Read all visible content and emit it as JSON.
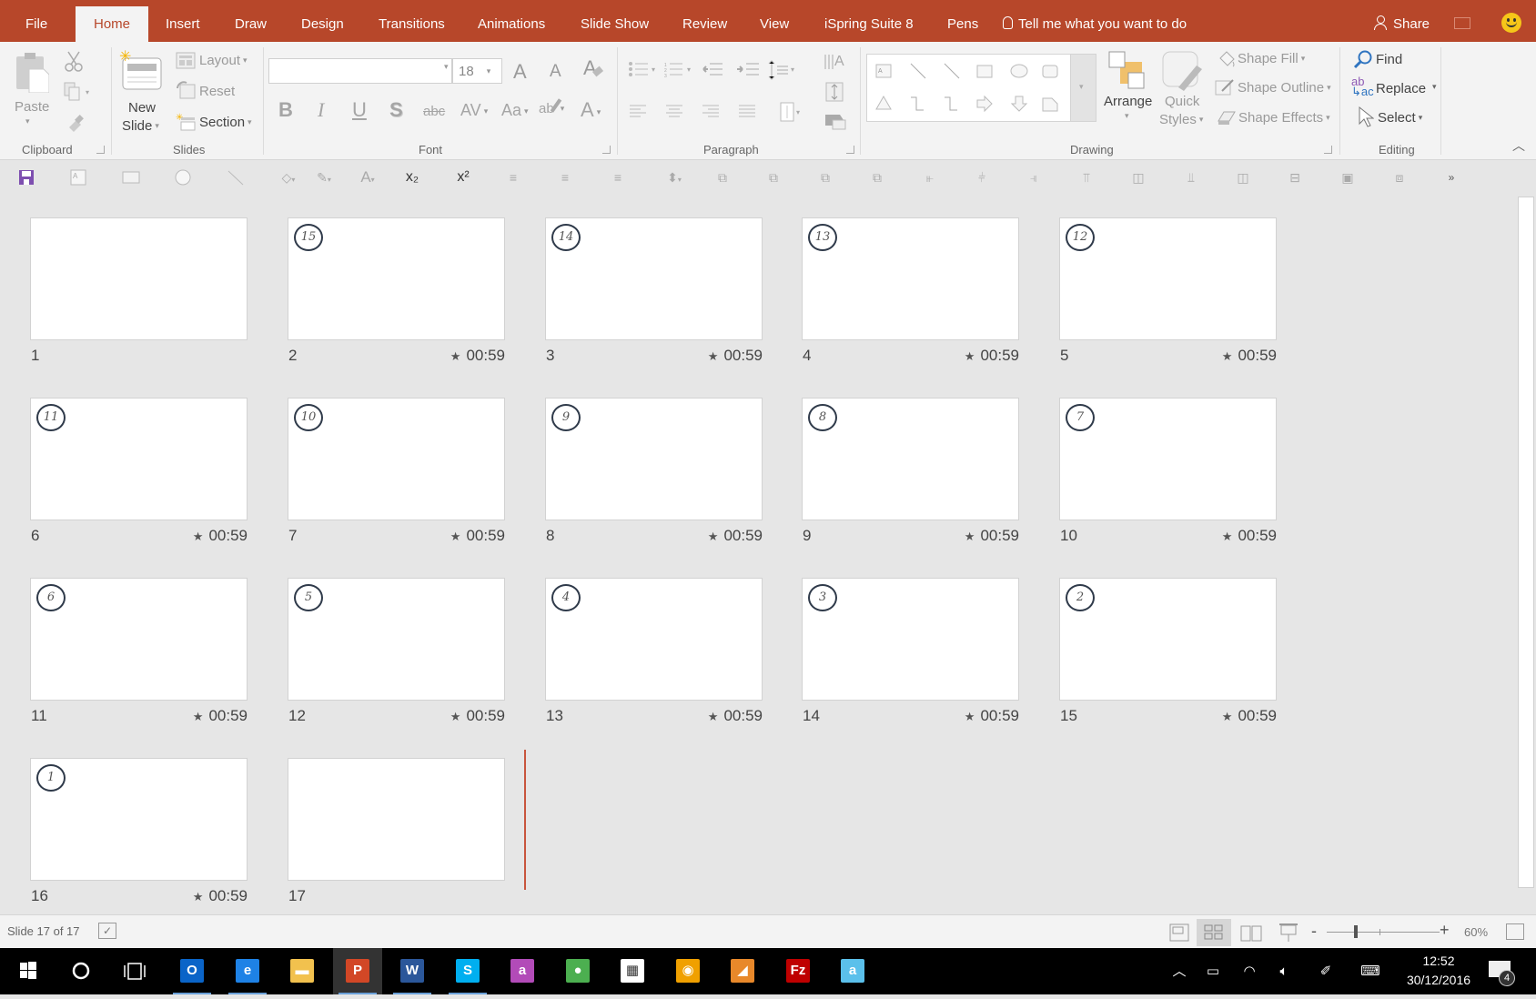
{
  "tabs": [
    {
      "label": "File",
      "active": false
    },
    {
      "label": "Home",
      "active": true
    },
    {
      "label": "Insert",
      "active": false
    },
    {
      "label": "Draw",
      "active": false
    },
    {
      "label": "Design",
      "active": false
    },
    {
      "label": "Transitions",
      "active": false
    },
    {
      "label": "Animations",
      "active": false
    },
    {
      "label": "Slide Show",
      "active": false
    },
    {
      "label": "Review",
      "active": false
    },
    {
      "label": "View",
      "active": false
    },
    {
      "label": "iSpring Suite 8",
      "active": false
    },
    {
      "label": "Pens",
      "active": false
    }
  ],
  "tell_me": "Tell me what you want to do",
  "share_label": "Share",
  "accent_color": "#B7472A",
  "ribbon": {
    "clipboard": {
      "label": "Clipboard",
      "paste": "Paste"
    },
    "slides": {
      "label": "Slides",
      "new_slide_line1": "New",
      "new_slide_line2": "Slide",
      "layout": "Layout",
      "reset": "Reset",
      "section": "Section"
    },
    "font": {
      "label": "Font",
      "font_name": "",
      "font_size": "18",
      "bold": "B",
      "italic": "I",
      "underline": "U",
      "shadow": "S",
      "strike": "abc",
      "spacing": "AV",
      "case": "Aa",
      "grow": "A",
      "shrink": "A",
      "color": "A"
    },
    "paragraph": {
      "label": "Paragraph"
    },
    "drawing": {
      "label": "Drawing",
      "arrange": "Arrange",
      "quick_styles_line1": "Quick",
      "quick_styles_line2": "Styles",
      "shape_fill": "Shape Fill",
      "shape_outline": "Shape Outline",
      "shape_effects": "Shape Effects"
    },
    "editing": {
      "label": "Editing",
      "find": "Find",
      "replace": "Replace",
      "select": "Select"
    }
  },
  "qat": {
    "subscript": "x₂",
    "superscript": "x²",
    "text_color": "A",
    "more": "»"
  },
  "slides": [
    {
      "number": "1",
      "badge": "",
      "timing": ""
    },
    {
      "number": "2",
      "badge": "15",
      "timing": "00:59"
    },
    {
      "number": "3",
      "badge": "14",
      "timing": "00:59"
    },
    {
      "number": "4",
      "badge": "13",
      "timing": "00:59"
    },
    {
      "number": "5",
      "badge": "12",
      "timing": "00:59"
    },
    {
      "number": "6",
      "badge": "11",
      "timing": "00:59"
    },
    {
      "number": "7",
      "badge": "10",
      "timing": "00:59"
    },
    {
      "number": "8",
      "badge": "9",
      "timing": "00:59"
    },
    {
      "number": "9",
      "badge": "8",
      "timing": "00:59"
    },
    {
      "number": "10",
      "badge": "7",
      "timing": "00:59"
    },
    {
      "number": "11",
      "badge": "6",
      "timing": "00:59"
    },
    {
      "number": "12",
      "badge": "5",
      "timing": "00:59"
    },
    {
      "number": "13",
      "badge": "4",
      "timing": "00:59"
    },
    {
      "number": "14",
      "badge": "3",
      "timing": "00:59"
    },
    {
      "number": "15",
      "badge": "2",
      "timing": "00:59"
    },
    {
      "number": "16",
      "badge": "1",
      "timing": "00:59"
    },
    {
      "number": "17",
      "badge": "",
      "timing": ""
    }
  ],
  "status": {
    "slide_indicator": "Slide 17 of 17",
    "zoom_percent": "60%",
    "zoom_level": 0.6,
    "active_view": "slide-sorter"
  },
  "taskbar": {
    "apps": [
      {
        "name": "outlook",
        "glyph": "O",
        "color": "#0a64c8",
        "running": true,
        "active": false
      },
      {
        "name": "edge",
        "glyph": "e",
        "color": "#1e82e6",
        "running": true,
        "active": false
      },
      {
        "name": "file-explorer",
        "glyph": "▬",
        "color": "#f2c14e",
        "running": false,
        "active": false
      },
      {
        "name": "powerpoint",
        "glyph": "P",
        "color": "#d24726",
        "running": true,
        "active": true
      },
      {
        "name": "word",
        "glyph": "W",
        "color": "#2b579a",
        "running": true,
        "active": false
      },
      {
        "name": "skype",
        "glyph": "S",
        "color": "#00aff0",
        "running": true,
        "active": false
      },
      {
        "name": "app-a",
        "glyph": "a",
        "color": "#b24bb8",
        "running": false,
        "active": false
      },
      {
        "name": "chrome",
        "glyph": "●",
        "color": "#4caf50",
        "running": false,
        "active": false
      },
      {
        "name": "calculator",
        "glyph": "▦",
        "color": "#ffffff",
        "running": false,
        "active": false
      },
      {
        "name": "audacity",
        "glyph": "◉",
        "color": "#f0a000",
        "running": false,
        "active": false
      },
      {
        "name": "app-orange",
        "glyph": "◢",
        "color": "#e8882a",
        "running": false,
        "active": false
      },
      {
        "name": "filezilla",
        "glyph": "Fz",
        "color": "#bf0000",
        "running": false,
        "active": false
      },
      {
        "name": "app-blue-a",
        "glyph": "a",
        "color": "#5bc0eb",
        "running": false,
        "active": false
      }
    ],
    "time": "12:52",
    "date": "30/12/2016",
    "notification_count": "4"
  }
}
